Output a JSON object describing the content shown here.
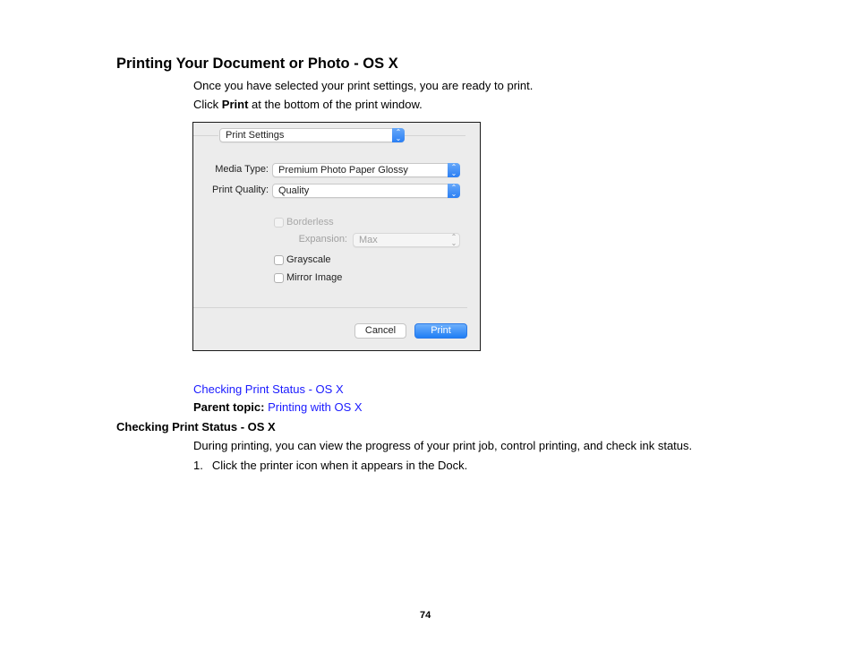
{
  "heading": "Printing Your Document or Photo - OS X",
  "intro": "Once you have selected your print settings, you are ready to print.",
  "instruction": {
    "prefix": "Click ",
    "bold": "Print",
    "suffix": " at the bottom of the print window."
  },
  "dialog": {
    "section_popup": "Print Settings",
    "media_type_label": "Media Type:",
    "media_type_value": "Premium Photo Paper Glossy",
    "print_quality_label": "Print Quality:",
    "print_quality_value": "Quality",
    "borderless_label": "Borderless",
    "borderless_checked": false,
    "expansion_label": "Expansion:",
    "expansion_value": "Max",
    "grayscale_label": "Grayscale",
    "grayscale_checked": false,
    "mirror_label": "Mirror Image",
    "mirror_checked": false,
    "cancel_label": "Cancel",
    "print_label": "Print",
    "arrows_glyph": "⌃⌄"
  },
  "related_link": "Checking Print Status - OS X",
  "parent_topic": {
    "label": "Parent topic:",
    "link": "Printing with OS X"
  },
  "subheading": "Checking Print Status - OS X",
  "description": "During printing, you can view the progress of your print job, control printing, and check ink status.",
  "steps": [
    {
      "number": "1.",
      "text": "Click the printer icon when it appears in the Dock."
    }
  ],
  "page_number": "74"
}
